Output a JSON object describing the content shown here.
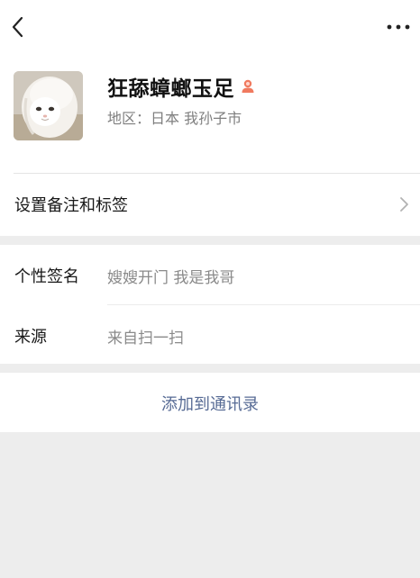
{
  "profile": {
    "name": "狂舔蟑螂玉足",
    "region": "地区：日本  我孙子市",
    "gender_icon": "female-icon"
  },
  "remark_row": {
    "label": "设置备注和标签"
  },
  "info": {
    "signature_label": "个性签名",
    "signature_value": "嫂嫂开门 我是我哥",
    "source_label": "来源",
    "source_value": "来自扫一扫"
  },
  "add_contact": {
    "label": "添加到通讯录"
  },
  "colors": {
    "link": "#576b95",
    "gender_icon": "#f07a5f",
    "background": "#ededed"
  }
}
